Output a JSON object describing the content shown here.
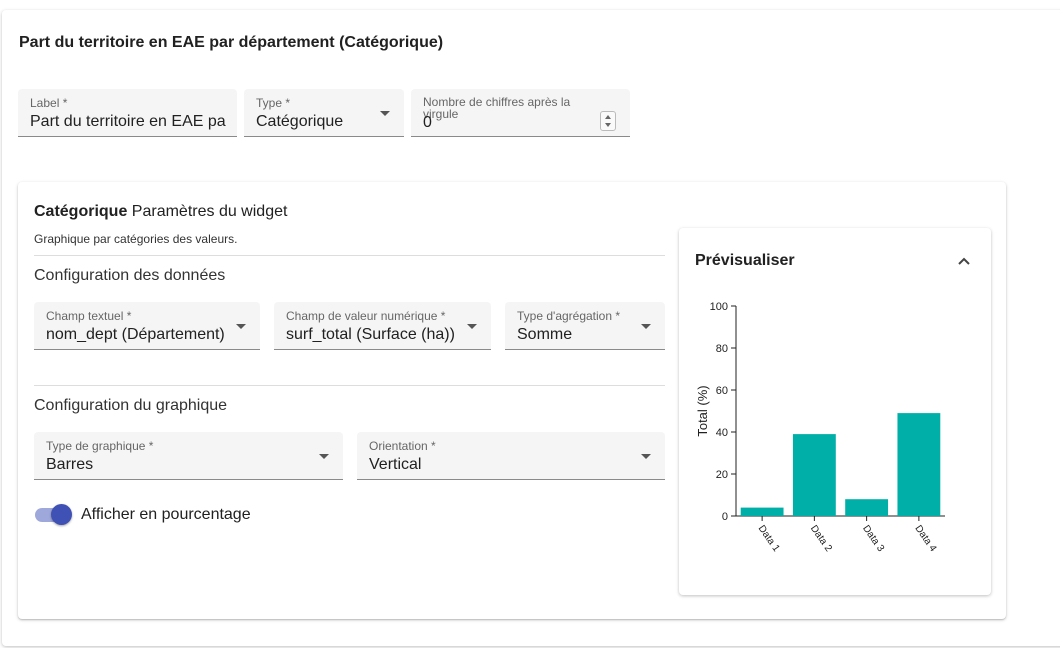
{
  "page": {
    "title": "Part du territoire en EAE par département (Catégorique)"
  },
  "top_fields": {
    "label": {
      "label": "Label *",
      "value": "Part du territoire en EAE par département"
    },
    "type": {
      "label": "Type *",
      "value": "Catégorique"
    },
    "digits": {
      "label": "Nombre de chiffres après la virgule",
      "value": "0"
    }
  },
  "widget": {
    "title_bold": "Catégorique",
    "title_rest": "Paramètres du widget",
    "subtitle": "Graphique par catégories des valeurs.",
    "data_config": {
      "title": "Configuration des données",
      "text_field": {
        "label": "Champ textuel *",
        "value": "nom_dept (Département)"
      },
      "value_field": {
        "label": "Champ de valeur numérique *",
        "value": "surf_total (Surface (ha))"
      },
      "aggregation": {
        "label": "Type d'agrégation *",
        "value": "Somme"
      }
    },
    "chart_config": {
      "title": "Configuration du graphique",
      "chart_type": {
        "label": "Type de graphique *",
        "value": "Barres"
      },
      "orientation": {
        "label": "Orientation *",
        "value": "Vertical"
      }
    },
    "percentage_toggle": {
      "label": "Afficher en pourcentage",
      "checked": true
    }
  },
  "preview": {
    "title": "Prévisualiser",
    "icon": "chevron-up-icon"
  },
  "colors": {
    "accent": "#3f51b5",
    "bar": "#00b0a8"
  },
  "chart_data": {
    "type": "bar",
    "categories": [
      "Data 1",
      "Data 2",
      "Data 3",
      "Data 4"
    ],
    "values": [
      4,
      39,
      8,
      49
    ],
    "ylabel": "Total (%)",
    "xlabel": "",
    "ylim": [
      0,
      100
    ],
    "yticks": [
      0,
      20,
      40,
      60,
      80,
      100
    ],
    "grid": false
  }
}
